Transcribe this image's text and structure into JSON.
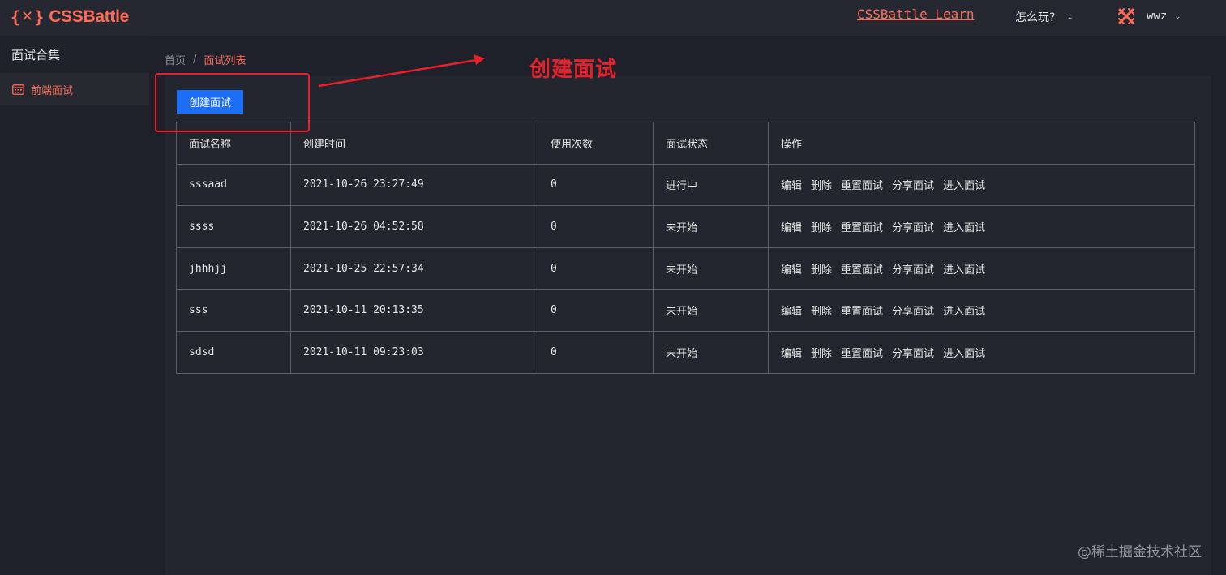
{
  "header": {
    "logo_left": "{",
    "logo_x": "✕",
    "logo_right": "}",
    "logo_text": "CSSBattle",
    "learn_link": "CSSBattle Learn",
    "how_to_play": "怎么玩?",
    "user_name": "wwz"
  },
  "sidebar": {
    "title": "面试合集",
    "items": [
      {
        "label": "前端面试",
        "icon": "calendar-icon"
      }
    ]
  },
  "breadcrumb": {
    "home": "首页",
    "separator": "/",
    "current": "面试列表"
  },
  "toolbar": {
    "create_label": "创建面试"
  },
  "table": {
    "columns": [
      "面试名称",
      "创建时间",
      "使用次数",
      "面试状态",
      "操作"
    ],
    "actions": [
      "编辑",
      "删除",
      "重置面试",
      "分享面试",
      "进入面试"
    ],
    "rows": [
      {
        "name": "sssaad",
        "created": "2021-10-26 23:27:49",
        "uses": "0",
        "status": "进行中"
      },
      {
        "name": "ssss",
        "created": "2021-10-26 04:52:58",
        "uses": "0",
        "status": "未开始"
      },
      {
        "name": "jhhhjj",
        "created": "2021-10-25 22:57:34",
        "uses": "0",
        "status": "未开始"
      },
      {
        "name": "sss",
        "created": "2021-10-11 20:13:35",
        "uses": "0",
        "status": "未开始"
      },
      {
        "name": "sdsd",
        "created": "2021-10-11 09:23:03",
        "uses": "0",
        "status": "未开始"
      }
    ]
  },
  "annotation": {
    "text": "创建面试"
  },
  "watermark": "@稀土掘金技术社区",
  "colors": {
    "accent": "#ff6b5b",
    "primary_button": "#1d6ef5",
    "annotation_red": "#e8202a",
    "background": "#1e2129"
  }
}
